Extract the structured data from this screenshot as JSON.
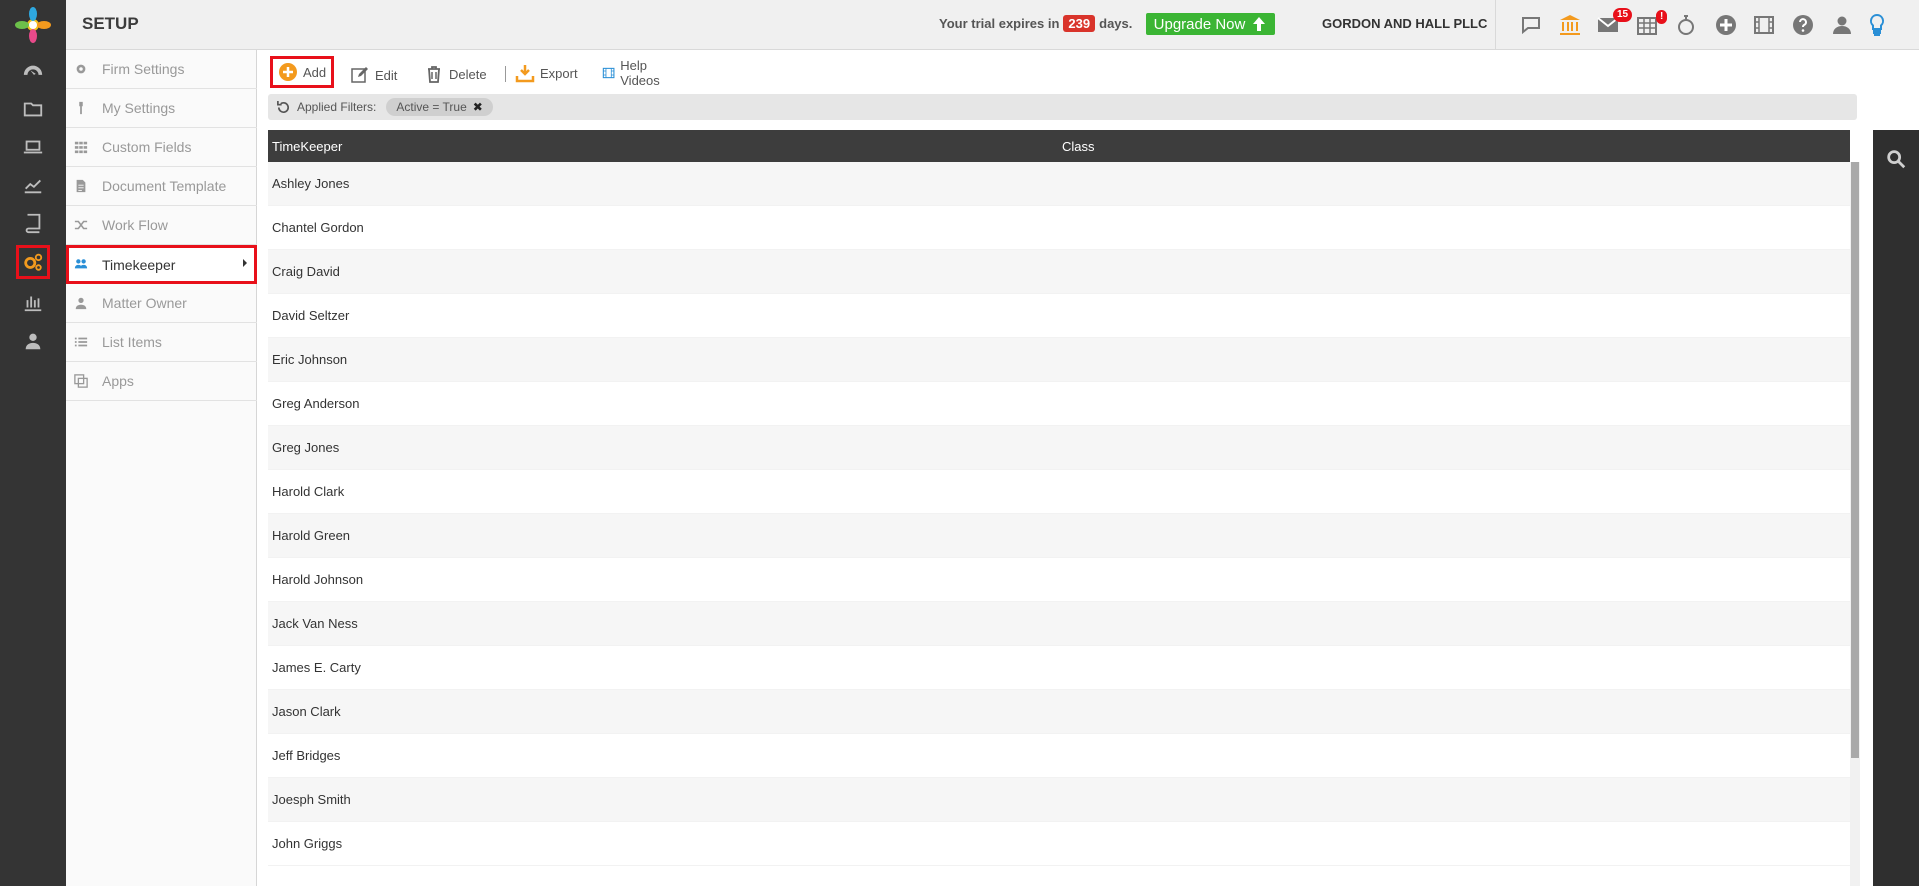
{
  "header": {
    "title": "SETUP",
    "trial_prefix": "Your trial expires in",
    "trial_days": "239",
    "trial_suffix": "days.",
    "upgrade_label": "Upgrade Now",
    "firm_name": "GORDON AND HALL PLLC",
    "mail_badge": "15",
    "calendar_badge": "!"
  },
  "sidebar": {
    "items": [
      {
        "label": "Firm Settings",
        "icon": "gear-icon"
      },
      {
        "label": "My Settings",
        "icon": "wrench-icon"
      },
      {
        "label": "Custom Fields",
        "icon": "grid-icon"
      },
      {
        "label": "Document Template",
        "icon": "document-icon"
      },
      {
        "label": "Work Flow",
        "icon": "shuffle-icon"
      },
      {
        "label": "Timekeeper",
        "icon": "users-icon",
        "active": true
      },
      {
        "label": "Matter Owner",
        "icon": "user-icon"
      },
      {
        "label": "List Items",
        "icon": "list-icon"
      },
      {
        "label": "Apps",
        "icon": "apps-icon"
      }
    ]
  },
  "toolbar": {
    "add_label": "Add",
    "edit_label": "Edit",
    "delete_label": "Delete",
    "export_label": "Export",
    "help_label": "Help Videos"
  },
  "filters": {
    "label": "Applied Filters:",
    "chip": "Active = True"
  },
  "table": {
    "columns": [
      "TimeKeeper",
      "Class"
    ],
    "rows": [
      "Ashley Jones",
      "Chantel Gordon",
      "Craig David",
      "David Seltzer",
      "Eric Johnson",
      "Greg Anderson",
      "Greg Jones",
      "Harold Clark",
      "Harold Green",
      "Harold Johnson",
      "Jack Van Ness",
      "James E. Carty",
      "Jason Clark",
      "Jeff Bridges",
      "Joesph Smith",
      "John Griggs"
    ]
  },
  "colors": {
    "accent_red": "#e8101a",
    "upgrade_green": "#3bb534",
    "rail_dark": "#343434",
    "orange_icon": "#f39a1e",
    "blue_icon": "#2a8fd6"
  }
}
